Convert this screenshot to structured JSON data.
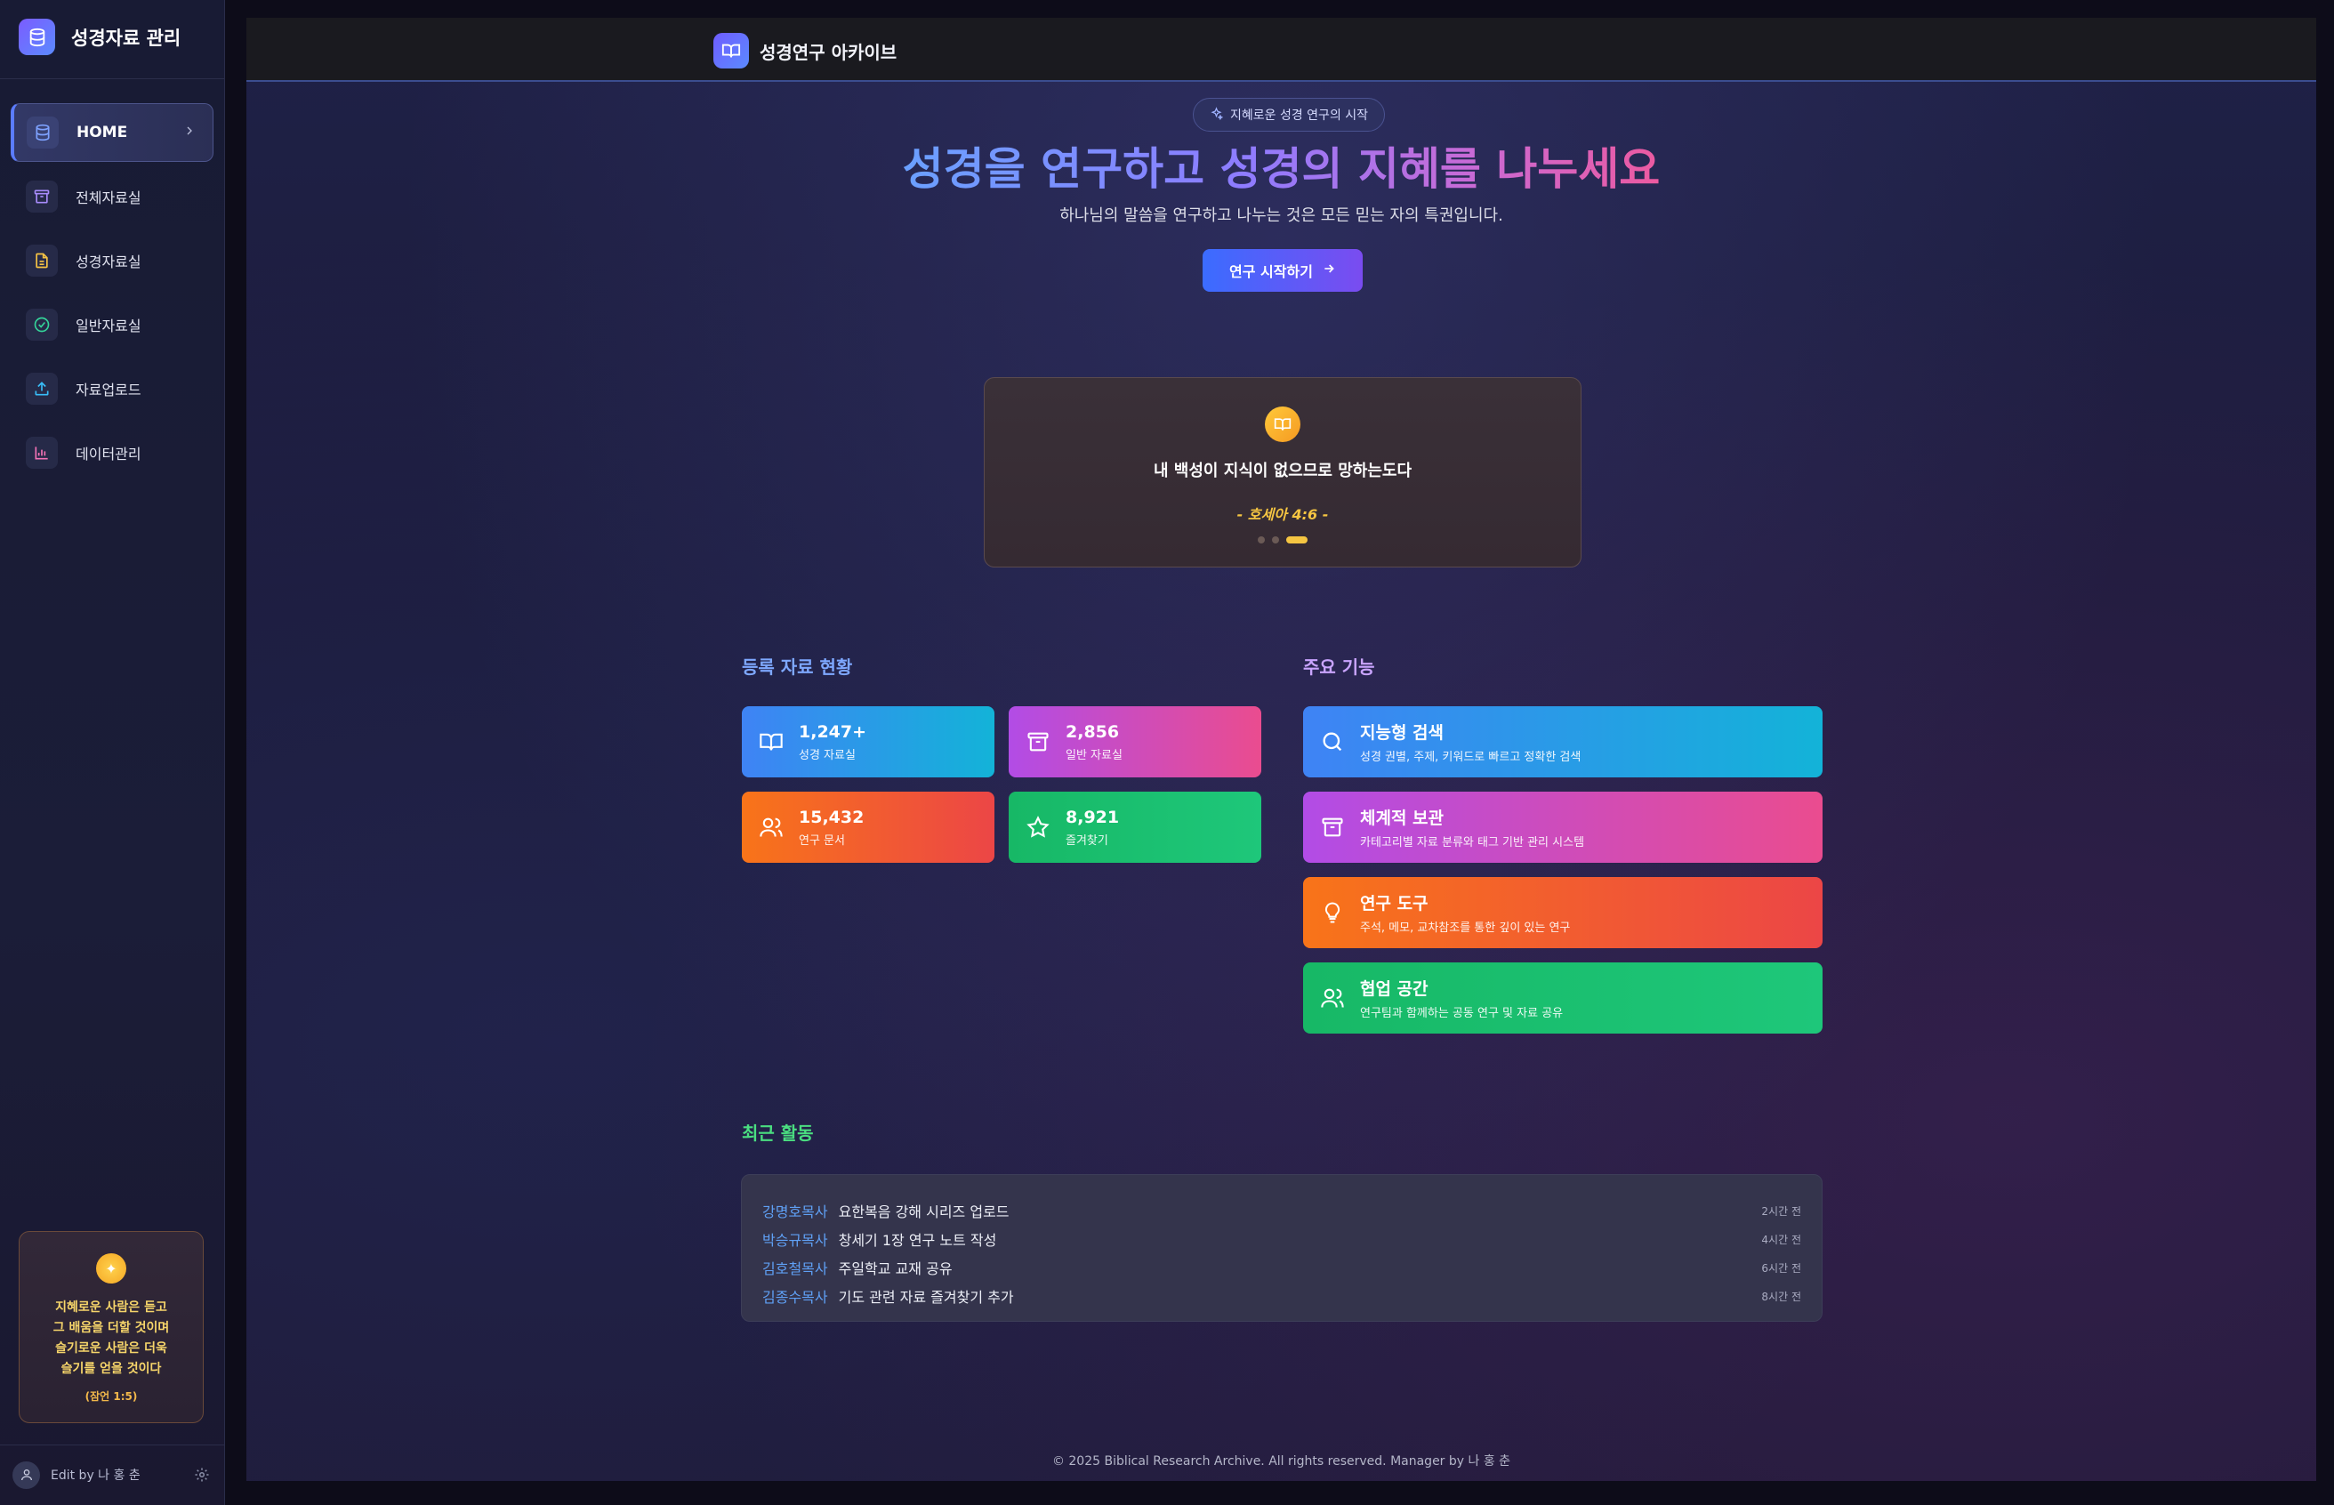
{
  "sidebar": {
    "brand_title": "성경자료 관리",
    "items": [
      {
        "label": "HOME",
        "icon": "database-icon",
        "color": "#7ea2ff"
      },
      {
        "label": "전체자료실",
        "icon": "archive-icon",
        "color": "#a78bfa"
      },
      {
        "label": "성경자료실",
        "icon": "file-text-icon",
        "color": "#f6c344"
      },
      {
        "label": "일반자료실",
        "icon": "check-circle-icon",
        "color": "#34d399"
      },
      {
        "label": "자료업로드",
        "icon": "upload-icon",
        "color": "#38bdf8"
      },
      {
        "label": "데이터관리",
        "icon": "bar-chart-icon",
        "color": "#f472b6"
      }
    ],
    "verse": {
      "lines": [
        "지혜로운 사람은 듣고",
        "그 배움을 더할 것이며",
        "슬기로운 사람은 더욱",
        "슬기를 얻을 것이다"
      ],
      "ref": "(잠언 1:5)"
    },
    "user_name": "Edit by 나 홍 춘"
  },
  "header": {
    "title": "성경연구 아카이브"
  },
  "hero": {
    "badge": "지혜로운 성경 연구의 시작",
    "title": "성경을 연구하고 성경의 지혜를 나누세요",
    "subtitle": "하나님의 말씀을 연구하고 나누는 것은 모든 믿는 자의 특권입니다.",
    "cta_label": "연구 시작하기"
  },
  "quote": {
    "text": "내 백성이 지식이 없으므로 망하는도다",
    "ref": "- 호세아 4:6 -",
    "slide_count": 3,
    "active_slide": 3
  },
  "stats": {
    "title": "등록 자료 현황",
    "cards": [
      {
        "value": "1,247+",
        "label": "성경 자료실"
      },
      {
        "value": "2,856",
        "label": "일반 자료실"
      },
      {
        "value": "15,432",
        "label": "연구 문서"
      },
      {
        "value": "8,921",
        "label": "즐겨찾기"
      }
    ]
  },
  "features": {
    "title": "주요 기능",
    "cards": [
      {
        "title": "지능형 검색",
        "desc": "성경 권별, 주제, 키워드로 빠르고 정확한 검색"
      },
      {
        "title": "체계적 보관",
        "desc": "카테고리별 자료 분류와 태그 기반 관리 시스템"
      },
      {
        "title": "연구 도구",
        "desc": "주석, 메모, 교차참조를 통한 깊이 있는 연구"
      },
      {
        "title": "협업 공간",
        "desc": "연구팀과 함께하는 공동 연구 및 자료 공유"
      }
    ]
  },
  "activity": {
    "title": "최근 활동",
    "rows": [
      {
        "user": "강명호목사",
        "text": "요한복음 강해 시리즈 업로드",
        "time": "2시간 전"
      },
      {
        "user": "박승규목사",
        "text": "창세기 1장 연구 노트 작성",
        "time": "4시간 전"
      },
      {
        "user": "김호철목사",
        "text": "주일학교 교재 공유",
        "time": "6시간 전"
      },
      {
        "user": "김종수목사",
        "text": "기도 관련 자료 즐겨찾기 추가",
        "time": "8시간 전"
      }
    ]
  },
  "footer": {
    "text": "© 2025 Biblical Research Archive. All rights reserved. Manager by 나 홍 춘"
  },
  "colors": {
    "stats_title": "#7ea8ff",
    "features_title": "#c9a4ff",
    "activity_title": "#4ade80"
  }
}
